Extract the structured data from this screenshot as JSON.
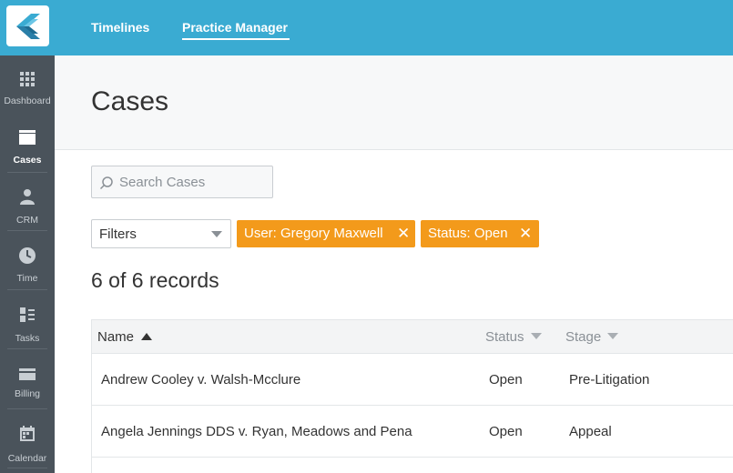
{
  "app": {
    "logo_icon": "filevine-logo-icon",
    "accent_color": "#3aabd2",
    "chip_color": "#f39a1b"
  },
  "topnav": {
    "tabs": [
      {
        "label": "Timelines",
        "active": false
      },
      {
        "label": "Practice Manager",
        "active": true
      }
    ]
  },
  "sidebar": {
    "items": [
      {
        "label": "Dashboard",
        "icon": "grid-icon",
        "active": false
      },
      {
        "label": "Cases",
        "icon": "folder-icon",
        "active": true
      },
      {
        "label": "CRM",
        "icon": "person-icon",
        "active": false
      },
      {
        "label": "Time",
        "icon": "clock-icon",
        "active": false
      },
      {
        "label": "Tasks",
        "icon": "tasks-icon",
        "active": false
      },
      {
        "label": "Billing",
        "icon": "billing-icon",
        "active": false
      },
      {
        "label": "Calendar",
        "icon": "calendar-icon",
        "active": false
      }
    ]
  },
  "page": {
    "title": "Cases"
  },
  "search": {
    "placeholder": "Search Cases",
    "value": ""
  },
  "filters": {
    "select_label": "Filters",
    "chips": [
      {
        "label": "User: Gregory Maxwell",
        "remove": "✕"
      },
      {
        "label": "Status: Open",
        "remove": "✕"
      }
    ]
  },
  "records": {
    "summary": "6 of 6 records"
  },
  "table": {
    "columns": [
      {
        "label": "Name",
        "sort": "ascending"
      },
      {
        "label": "Status",
        "sort": "none"
      },
      {
        "label": "Stage",
        "sort": "none"
      }
    ],
    "rows": [
      {
        "name": "Andrew Cooley v. Walsh-Mcclure",
        "status": "Open",
        "stage": "Pre-Litigation"
      },
      {
        "name": "Angela Jennings DDS v. Ryan, Meadows and Pena",
        "status": "Open",
        "stage": "Appeal"
      }
    ]
  }
}
